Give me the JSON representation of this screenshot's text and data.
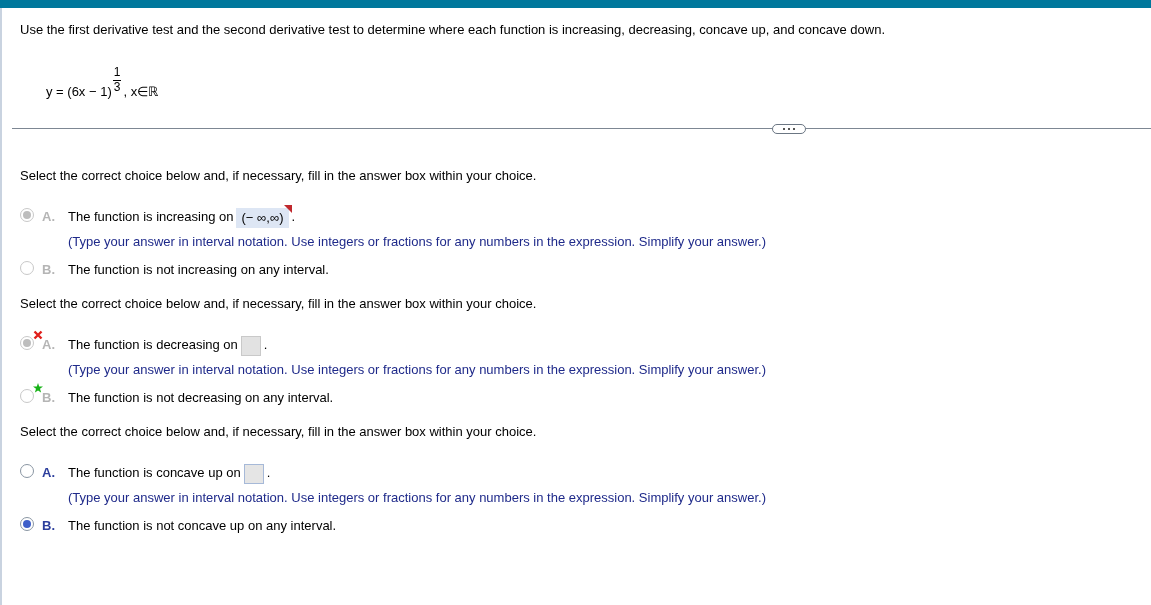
{
  "instructions": "Use the first derivative test and the second derivative test to determine where each function is increasing, decreasing, concave up, and concave down.",
  "equation": {
    "base": "y = (6x − 1)",
    "numerator": "1",
    "denominator": "3",
    "domain": ", x∈ℝ"
  },
  "questions": [
    {
      "prompt": "Select the correct choice below and, if necessary, fill in the answer box within your choice.",
      "choices": [
        {
          "letter": "A.",
          "kind": "answer",
          "text": "The function is increasing on",
          "answer": "(− ∞,∞)",
          "flagged": true,
          "after": ".",
          "hint": "(Type your answer in interval notation. Use integers or fractions for any numbers in the expression. Simplify your answer.)",
          "selected": true,
          "disabled": true,
          "incorrect": false,
          "correct": false
        },
        {
          "letter": "B.",
          "kind": "plain",
          "text": "The function is not increasing on any interval.",
          "selected": false,
          "disabled": true,
          "incorrect": false,
          "correct": false
        }
      ]
    },
    {
      "prompt": "Select the correct choice below and, if necessary, fill in the answer box within your choice.",
      "choices": [
        {
          "letter": "A.",
          "kind": "answer",
          "text": "The function is decreasing on",
          "flagged": false,
          "after": ".",
          "hint": "(Type your answer in interval notation. Use integers or fractions for any numbers in the expression. Simplify your answer.)",
          "selected": true,
          "disabled": true,
          "incorrect": true,
          "correct": false
        },
        {
          "letter": "B.",
          "kind": "plain",
          "text": "The function is not decreasing on any interval.",
          "selected": false,
          "disabled": true,
          "incorrect": false,
          "correct": true
        }
      ]
    },
    {
      "prompt": "Select the correct choice below and, if necessary, fill in the answer box within your choice.",
      "choices": [
        {
          "letter": "A.",
          "kind": "answer",
          "text": "The function is concave up on",
          "flagged": false,
          "after": ".",
          "hint": "(Type your answer in interval notation. Use integers or fractions for any numbers in the expression. Simplify your answer.)",
          "selected": false,
          "disabled": false,
          "incorrect": false,
          "correct": false
        },
        {
          "letter": "B.",
          "kind": "plain",
          "text": "The function is not concave up on any interval.",
          "selected": true,
          "disabled": false,
          "incorrect": false,
          "correct": false
        }
      ]
    }
  ]
}
